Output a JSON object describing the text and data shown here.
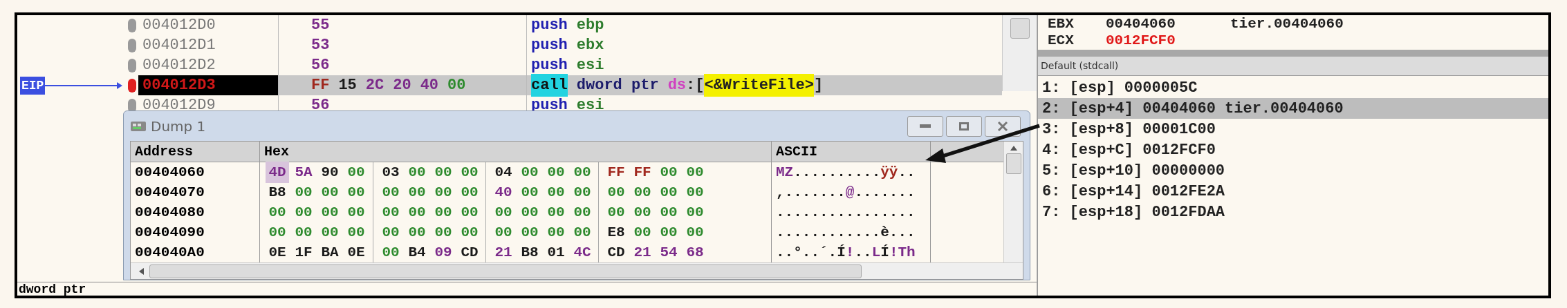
{
  "disassembly": {
    "eip_label": "EIP",
    "rows": [
      {
        "address": "004012D0",
        "selected": false,
        "bytes": [
          {
            "text": "55",
            "color": "#7b2a8a"
          }
        ],
        "instruction": [
          {
            "text": "push",
            "kind": "mnemonic"
          },
          {
            "text": "ebp",
            "kind": "register"
          }
        ]
      },
      {
        "address": "004012D1",
        "selected": false,
        "bytes": [
          {
            "text": "53",
            "color": "#7b2a8a"
          }
        ],
        "instruction": [
          {
            "text": "push",
            "kind": "mnemonic"
          },
          {
            "text": "ebx",
            "kind": "register"
          }
        ]
      },
      {
        "address": "004012D2",
        "selected": false,
        "bytes": [
          {
            "text": "56",
            "color": "#7b2a8a"
          }
        ],
        "instruction": [
          {
            "text": "push",
            "kind": "mnemonic"
          },
          {
            "text": "esi",
            "kind": "register"
          }
        ]
      },
      {
        "address": "004012D3",
        "selected": true,
        "bytes": [
          {
            "text": "FF",
            "color": "#a0281e"
          },
          {
            "text": "15",
            "color": "#1a1a1a"
          },
          {
            "text": "2C",
            "color": "#7b2a8a"
          },
          {
            "text": "20",
            "color": "#7b2a8a"
          },
          {
            "text": "40",
            "color": "#7b2a8a"
          },
          {
            "text": "00",
            "color": "#2e8b2e"
          }
        ],
        "instruction": [
          {
            "text": "call",
            "kind": "call"
          },
          {
            "text": "dword ptr",
            "kind": "keyword"
          },
          {
            "text": "ds",
            "kind": "segment"
          },
          {
            "text": ":[",
            "kind": "punct"
          },
          {
            "text": "<&WriteFile>",
            "kind": "symbol"
          },
          {
            "text": "]",
            "kind": "punct"
          }
        ]
      },
      {
        "address": "004012D9",
        "selected": false,
        "bytes": [
          {
            "text": "56",
            "color": "#7b2a8a"
          }
        ],
        "instruction": [
          {
            "text": "push",
            "kind": "mnemonic"
          },
          {
            "text": "esi",
            "kind": "register"
          }
        ]
      }
    ],
    "status": "dword ptr"
  },
  "registers": [
    {
      "name": "EBX",
      "value": "00404060",
      "comment": "tier.00404060",
      "changed": false
    },
    {
      "name": "ECX",
      "value": "0012FCF0",
      "changed": true
    }
  ],
  "call_args": {
    "header": "Default (stdcall)",
    "rows": [
      {
        "text": "1: [esp] 0000005C",
        "selected": false
      },
      {
        "text": "2: [esp+4] 00404060 tier.00404060",
        "selected": true
      },
      {
        "text": "3: [esp+8] 00001C00",
        "selected": false
      },
      {
        "text": "4: [esp+C] 0012FCF0",
        "selected": false
      },
      {
        "text": "5: [esp+10] 00000000",
        "selected": false
      },
      {
        "text": "6: [esp+14] 0012FE2A",
        "selected": false
      },
      {
        "text": "7: [esp+18] 0012FDAA",
        "selected": false
      }
    ]
  },
  "dump_window": {
    "title": "Dump 1",
    "columns": [
      "Address",
      "Hex",
      "ASCII"
    ],
    "rows": [
      {
        "address": "00404060",
        "hex": [
          {
            "text": "4D",
            "color": "#7b2a8a",
            "selected": true
          },
          {
            "text": "5A",
            "color": "#7b2a8a",
            "selected": false
          },
          {
            "text": "90",
            "color": "#1a1a1a",
            "selected": false
          },
          {
            "text": "00",
            "color": "#2e8b2e",
            "selected": false
          },
          {
            "text": "03",
            "color": "#1a1a1a",
            "selected": false
          },
          {
            "text": "00",
            "color": "#2e8b2e",
            "selected": false
          },
          {
            "text": "00",
            "color": "#2e8b2e",
            "selected": false
          },
          {
            "text": "00",
            "color": "#2e8b2e",
            "selected": false
          },
          {
            "text": "04",
            "color": "#1a1a1a",
            "selected": false
          },
          {
            "text": "00",
            "color": "#2e8b2e",
            "selected": false
          },
          {
            "text": "00",
            "color": "#2e8b2e",
            "selected": false
          },
          {
            "text": "00",
            "color": "#2e8b2e",
            "selected": false
          },
          {
            "text": "FF",
            "color": "#a0281e",
            "selected": false
          },
          {
            "text": "FF",
            "color": "#a0281e",
            "selected": false
          },
          {
            "text": "00",
            "color": "#2e8b2e",
            "selected": false
          },
          {
            "text": "00",
            "color": "#2e8b2e",
            "selected": false
          }
        ],
        "ascii": [
          {
            "text": "MZ",
            "color": "#7b2a8a"
          },
          {
            "text": "..........",
            "color": "#1a1a1a"
          },
          {
            "text": "ÿÿ",
            "color": "#a0281e"
          },
          {
            "text": "..",
            "color": "#1a1a1a"
          }
        ]
      },
      {
        "address": "00404070",
        "hex": [
          {
            "text": "B8",
            "color": "#1a1a1a",
            "selected": false
          },
          {
            "text": "00",
            "color": "#2e8b2e",
            "selected": false
          },
          {
            "text": "00",
            "color": "#2e8b2e",
            "selected": false
          },
          {
            "text": "00",
            "color": "#2e8b2e",
            "selected": false
          },
          {
            "text": "00",
            "color": "#2e8b2e",
            "selected": false
          },
          {
            "text": "00",
            "color": "#2e8b2e",
            "selected": false
          },
          {
            "text": "00",
            "color": "#2e8b2e",
            "selected": false
          },
          {
            "text": "00",
            "color": "#2e8b2e",
            "selected": false
          },
          {
            "text": "40",
            "color": "#7b2a8a",
            "selected": false
          },
          {
            "text": "00",
            "color": "#2e8b2e",
            "selected": false
          },
          {
            "text": "00",
            "color": "#2e8b2e",
            "selected": false
          },
          {
            "text": "00",
            "color": "#2e8b2e",
            "selected": false
          },
          {
            "text": "00",
            "color": "#2e8b2e",
            "selected": false
          },
          {
            "text": "00",
            "color": "#2e8b2e",
            "selected": false
          },
          {
            "text": "00",
            "color": "#2e8b2e",
            "selected": false
          },
          {
            "text": "00",
            "color": "#2e8b2e",
            "selected": false
          }
        ],
        "ascii": [
          {
            "text": ",.......",
            "color": "#1a1a1a"
          },
          {
            "text": "@",
            "color": "#7b2a8a"
          },
          {
            "text": ".......",
            "color": "#1a1a1a"
          }
        ]
      },
      {
        "address": "00404080",
        "hex": [
          {
            "text": "00",
            "color": "#2e8b2e",
            "selected": false
          },
          {
            "text": "00",
            "color": "#2e8b2e",
            "selected": false
          },
          {
            "text": "00",
            "color": "#2e8b2e",
            "selected": false
          },
          {
            "text": "00",
            "color": "#2e8b2e",
            "selected": false
          },
          {
            "text": "00",
            "color": "#2e8b2e",
            "selected": false
          },
          {
            "text": "00",
            "color": "#2e8b2e",
            "selected": false
          },
          {
            "text": "00",
            "color": "#2e8b2e",
            "selected": false
          },
          {
            "text": "00",
            "color": "#2e8b2e",
            "selected": false
          },
          {
            "text": "00",
            "color": "#2e8b2e",
            "selected": false
          },
          {
            "text": "00",
            "color": "#2e8b2e",
            "selected": false
          },
          {
            "text": "00",
            "color": "#2e8b2e",
            "selected": false
          },
          {
            "text": "00",
            "color": "#2e8b2e",
            "selected": false
          },
          {
            "text": "00",
            "color": "#2e8b2e",
            "selected": false
          },
          {
            "text": "00",
            "color": "#2e8b2e",
            "selected": false
          },
          {
            "text": "00",
            "color": "#2e8b2e",
            "selected": false
          },
          {
            "text": "00",
            "color": "#2e8b2e",
            "selected": false
          }
        ],
        "ascii": [
          {
            "text": "................",
            "color": "#1a1a1a"
          }
        ]
      },
      {
        "address": "00404090",
        "hex": [
          {
            "text": "00",
            "color": "#2e8b2e",
            "selected": false
          },
          {
            "text": "00",
            "color": "#2e8b2e",
            "selected": false
          },
          {
            "text": "00",
            "color": "#2e8b2e",
            "selected": false
          },
          {
            "text": "00",
            "color": "#2e8b2e",
            "selected": false
          },
          {
            "text": "00",
            "color": "#2e8b2e",
            "selected": false
          },
          {
            "text": "00",
            "color": "#2e8b2e",
            "selected": false
          },
          {
            "text": "00",
            "color": "#2e8b2e",
            "selected": false
          },
          {
            "text": "00",
            "color": "#2e8b2e",
            "selected": false
          },
          {
            "text": "00",
            "color": "#2e8b2e",
            "selected": false
          },
          {
            "text": "00",
            "color": "#2e8b2e",
            "selected": false
          },
          {
            "text": "00",
            "color": "#2e8b2e",
            "selected": false
          },
          {
            "text": "00",
            "color": "#2e8b2e",
            "selected": false
          },
          {
            "text": "E8",
            "color": "#1a1a1a",
            "selected": false
          },
          {
            "text": "00",
            "color": "#2e8b2e",
            "selected": false
          },
          {
            "text": "00",
            "color": "#2e8b2e",
            "selected": false
          },
          {
            "text": "00",
            "color": "#2e8b2e",
            "selected": false
          }
        ],
        "ascii": [
          {
            "text": "............è...",
            "color": "#1a1a1a"
          }
        ]
      },
      {
        "address": "004040A0",
        "hex": [
          {
            "text": "0E",
            "color": "#1a1a1a",
            "selected": false
          },
          {
            "text": "1F",
            "color": "#1a1a1a",
            "selected": false
          },
          {
            "text": "BA",
            "color": "#1a1a1a",
            "selected": false
          },
          {
            "text": "0E",
            "color": "#1a1a1a",
            "selected": false
          },
          {
            "text": "00",
            "color": "#2e8b2e",
            "selected": false
          },
          {
            "text": "B4",
            "color": "#1a1a1a",
            "selected": false
          },
          {
            "text": "09",
            "color": "#7b2a8a",
            "selected": false
          },
          {
            "text": "CD",
            "color": "#1a1a1a",
            "selected": false
          },
          {
            "text": "21",
            "color": "#7b2a8a",
            "selected": false
          },
          {
            "text": "B8",
            "color": "#1a1a1a",
            "selected": false
          },
          {
            "text": "01",
            "color": "#1a1a1a",
            "selected": false
          },
          {
            "text": "4C",
            "color": "#7b2a8a",
            "selected": false
          },
          {
            "text": "CD",
            "color": "#1a1a1a",
            "selected": false
          },
          {
            "text": "21",
            "color": "#7b2a8a",
            "selected": false
          },
          {
            "text": "54",
            "color": "#7b2a8a",
            "selected": false
          },
          {
            "text": "68",
            "color": "#7b2a8a",
            "selected": false
          }
        ],
        "ascii": [
          {
            "text": "..°..´.Í",
            "color": "#1a1a1a"
          },
          {
            "text": "!",
            "color": "#7b2a8a"
          },
          {
            "text": "..",
            "color": "#1a1a1a"
          },
          {
            "text": "L",
            "color": "#7b2a8a"
          },
          {
            "text": "Í",
            "color": "#1a1a1a"
          },
          {
            "text": "!Th",
            "color": "#7b2a8a"
          }
        ]
      }
    ]
  }
}
